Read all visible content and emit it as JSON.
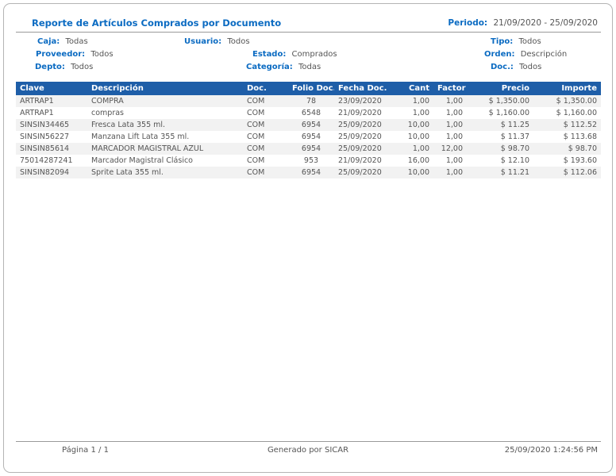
{
  "report": {
    "title": "Reporte de Artículos Comprados por Documento",
    "period_label": "Periodo:",
    "period_value": "21/09/2020 - 25/09/2020"
  },
  "filters": {
    "caja": {
      "label": "Caja:",
      "value": "Todas"
    },
    "usuario": {
      "label": "Usuario:",
      "value": "Todos"
    },
    "tipo": {
      "label": "Tipo:",
      "value": "Todos"
    },
    "proveedor": {
      "label": "Proveedor:",
      "value": "Todos"
    },
    "estado": {
      "label": "Estado:",
      "value": "Comprados"
    },
    "orden": {
      "label": "Orden:",
      "value": "Descripción"
    },
    "depto": {
      "label": "Depto:",
      "value": "Todos"
    },
    "categoria": {
      "label": "Categoría:",
      "value": "Todas"
    },
    "doc": {
      "label": "Doc.:",
      "value": "Todos"
    }
  },
  "table": {
    "headers": [
      "Clave",
      "Descripción",
      "Doc.",
      "Folio Doc.",
      "Fecha Doc.",
      "Cant",
      "Factor",
      "Precio",
      "Importe"
    ],
    "rows": [
      [
        "ARTRAP1",
        "COMPRA",
        "COM",
        "78",
        "23/09/2020",
        "1,00",
        "1,00",
        "$ 1,350.00",
        "$ 1,350.00"
      ],
      [
        "ARTRAP1",
        "compras",
        "COM",
        "6548",
        "21/09/2020",
        "1,00",
        "1,00",
        "$ 1,160.00",
        "$ 1,160.00"
      ],
      [
        "SINSIN34465",
        "Fresca Lata 355 ml.",
        "COM",
        "6954",
        "25/09/2020",
        "10,00",
        "1,00",
        "$ 11.25",
        "$ 112.52"
      ],
      [
        "SINSIN56227",
        "Manzana Lift Lata 355 ml.",
        "COM",
        "6954",
        "25/09/2020",
        "10,00",
        "1,00",
        "$ 11.37",
        "$ 113.68"
      ],
      [
        "SINSIN85614",
        "MARCADOR MAGISTRAL AZUL",
        "COM",
        "6954",
        "25/09/2020",
        "1,00",
        "12,00",
        "$ 98.70",
        "$ 98.70"
      ],
      [
        "75014287241",
        "Marcador Magistral Clásico",
        "COM",
        "953",
        "21/09/2020",
        "16,00",
        "1,00",
        "$ 12.10",
        "$ 193.60"
      ],
      [
        "SINSIN82094",
        "Sprite Lata 355 ml.",
        "COM",
        "6954",
        "25/09/2020",
        "10,00",
        "1,00",
        "$ 11.21",
        "$ 112.06"
      ]
    ]
  },
  "footer": {
    "page": "Página 1 / 1",
    "generated": "Generado por SICAR",
    "timestamp": "25/09/2020 1:24:56 PM"
  },
  "colors": {
    "label_blue": "#0b6bc2",
    "header_bg": "#1e5ea8",
    "alt_row_bg": "#f2f2f2",
    "text_gray": "#555555",
    "line_gray": "#9a9a9a",
    "border_gray": "#b4b4b4"
  }
}
